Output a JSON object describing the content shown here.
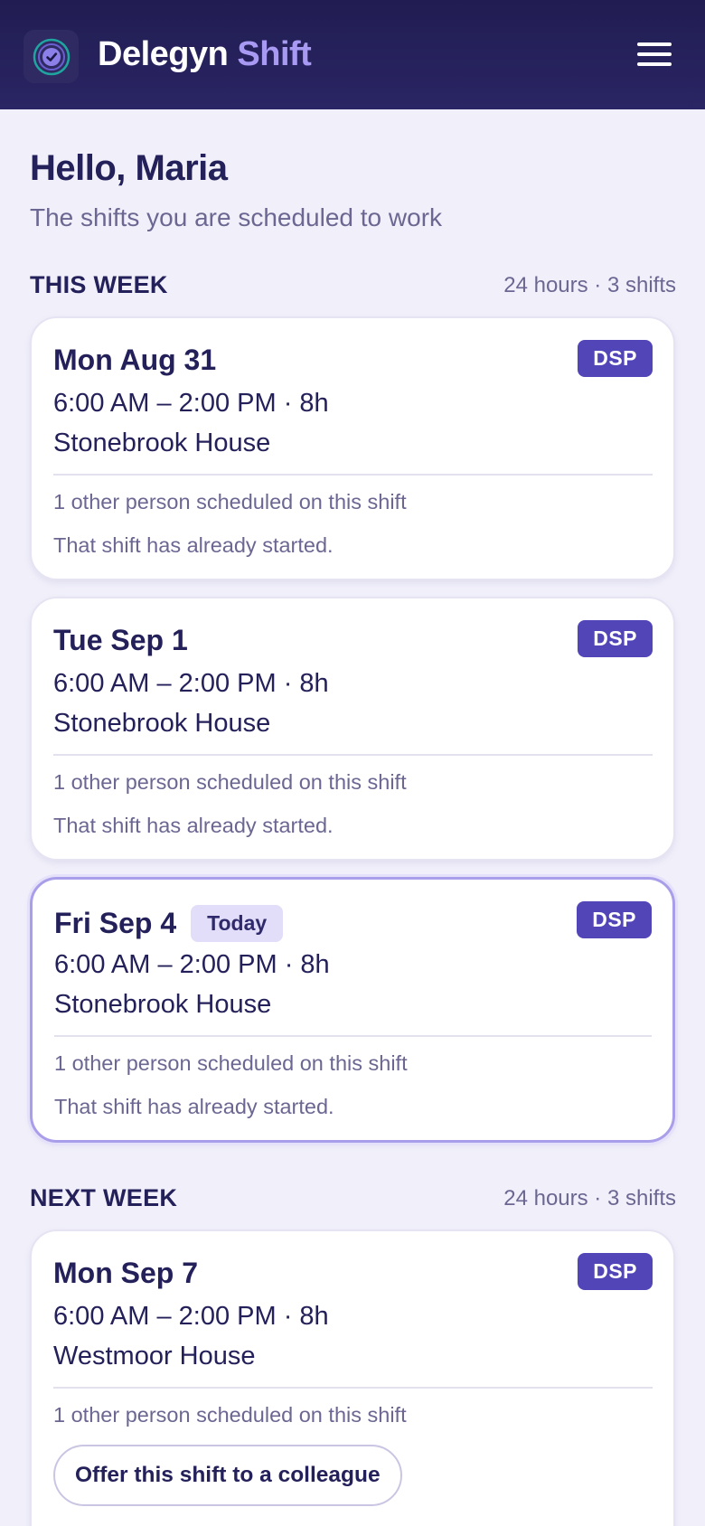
{
  "app": {
    "brand_main": "Delegyn",
    "brand_accent": "Shift",
    "logo_icon": "check-circle-icon",
    "menu_icon": "hamburger-menu-icon"
  },
  "colors": {
    "header": "#221e55",
    "accent": "#a89af2",
    "badge": "#5245b8",
    "today_badge": "#e2defa",
    "background": "#f1f0fa"
  },
  "greeting": "Hello, Maria",
  "subtitle": "The shifts you are scheduled to work",
  "sections": [
    {
      "title": "THIS WEEK",
      "meta": "24 hours · 3 shifts",
      "shifts": [
        {
          "date": "Mon Aug 31",
          "role": "DSP",
          "time": "6:00 AM – 2:00 PM · 8h",
          "location": "Stonebrook House",
          "people": "1 other person scheduled on this shift",
          "status": "That shift has already started."
        },
        {
          "date": "Tue Sep 1",
          "role": "DSP",
          "time": "6:00 AM – 2:00 PM · 8h",
          "location": "Stonebrook House",
          "people": "1 other person scheduled on this shift",
          "status": "That shift has already started."
        },
        {
          "date": "Fri Sep 4",
          "today_label": "Today",
          "role": "DSP",
          "time": "6:00 AM – 2:00 PM · 8h",
          "location": "Stonebrook House",
          "people": "1 other person scheduled on this shift",
          "status": "That shift has already started."
        }
      ]
    },
    {
      "title": "NEXT WEEK",
      "meta": "24 hours · 3 shifts",
      "shifts": [
        {
          "date": "Mon Sep 7",
          "role": "DSP",
          "time": "6:00 AM – 2:00 PM · 8h",
          "location": "Westmoor House",
          "people": "1 other person scheduled on this shift",
          "action": "Offer this shift to a colleague"
        }
      ]
    }
  ]
}
